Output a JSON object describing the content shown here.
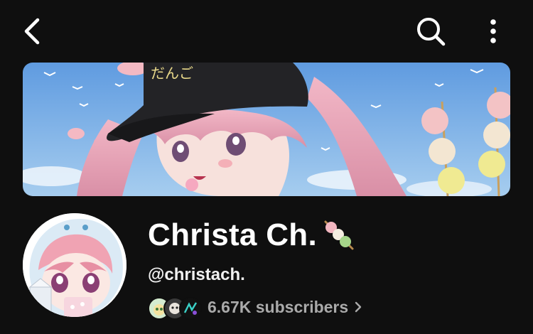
{
  "header": {
    "back_icon": "chevron-left-icon",
    "search_icon": "search-icon",
    "more_icon": "more-vertical-icon"
  },
  "banner": {
    "cap_text": "だんご"
  },
  "channel": {
    "name": "Christa Ch.",
    "name_emoji": "dango-emoji",
    "handle": "@christach.",
    "subscribers": "6.67K subscribers"
  },
  "colors": {
    "background": "#0f0f0f",
    "text_primary": "#ffffff",
    "text_secondary": "#aaaaaa",
    "sky": "#7fb4e6",
    "hair_pink": "#e9a6b8"
  }
}
